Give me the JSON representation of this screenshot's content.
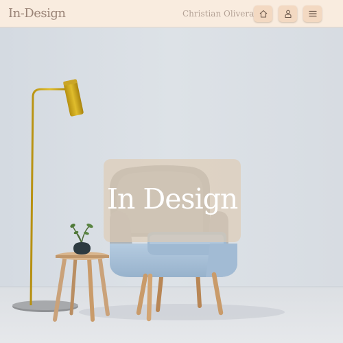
{
  "header": {
    "logo": "In-Design",
    "user_name": "Christian Olivera",
    "buttons": [
      {
        "icon": "home-icon"
      },
      {
        "icon": "user-icon"
      },
      {
        "icon": "menu-icon"
      }
    ]
  },
  "hero": {
    "title": "In Design"
  },
  "colors": {
    "header_bg": "#f9ecdf",
    "button_bg": "#f3d9c2",
    "wall": "#d9dee4",
    "lamp_gold": "#c9a51a",
    "chair_blue": "#a9c1d8",
    "wood": "#c99b6a"
  }
}
